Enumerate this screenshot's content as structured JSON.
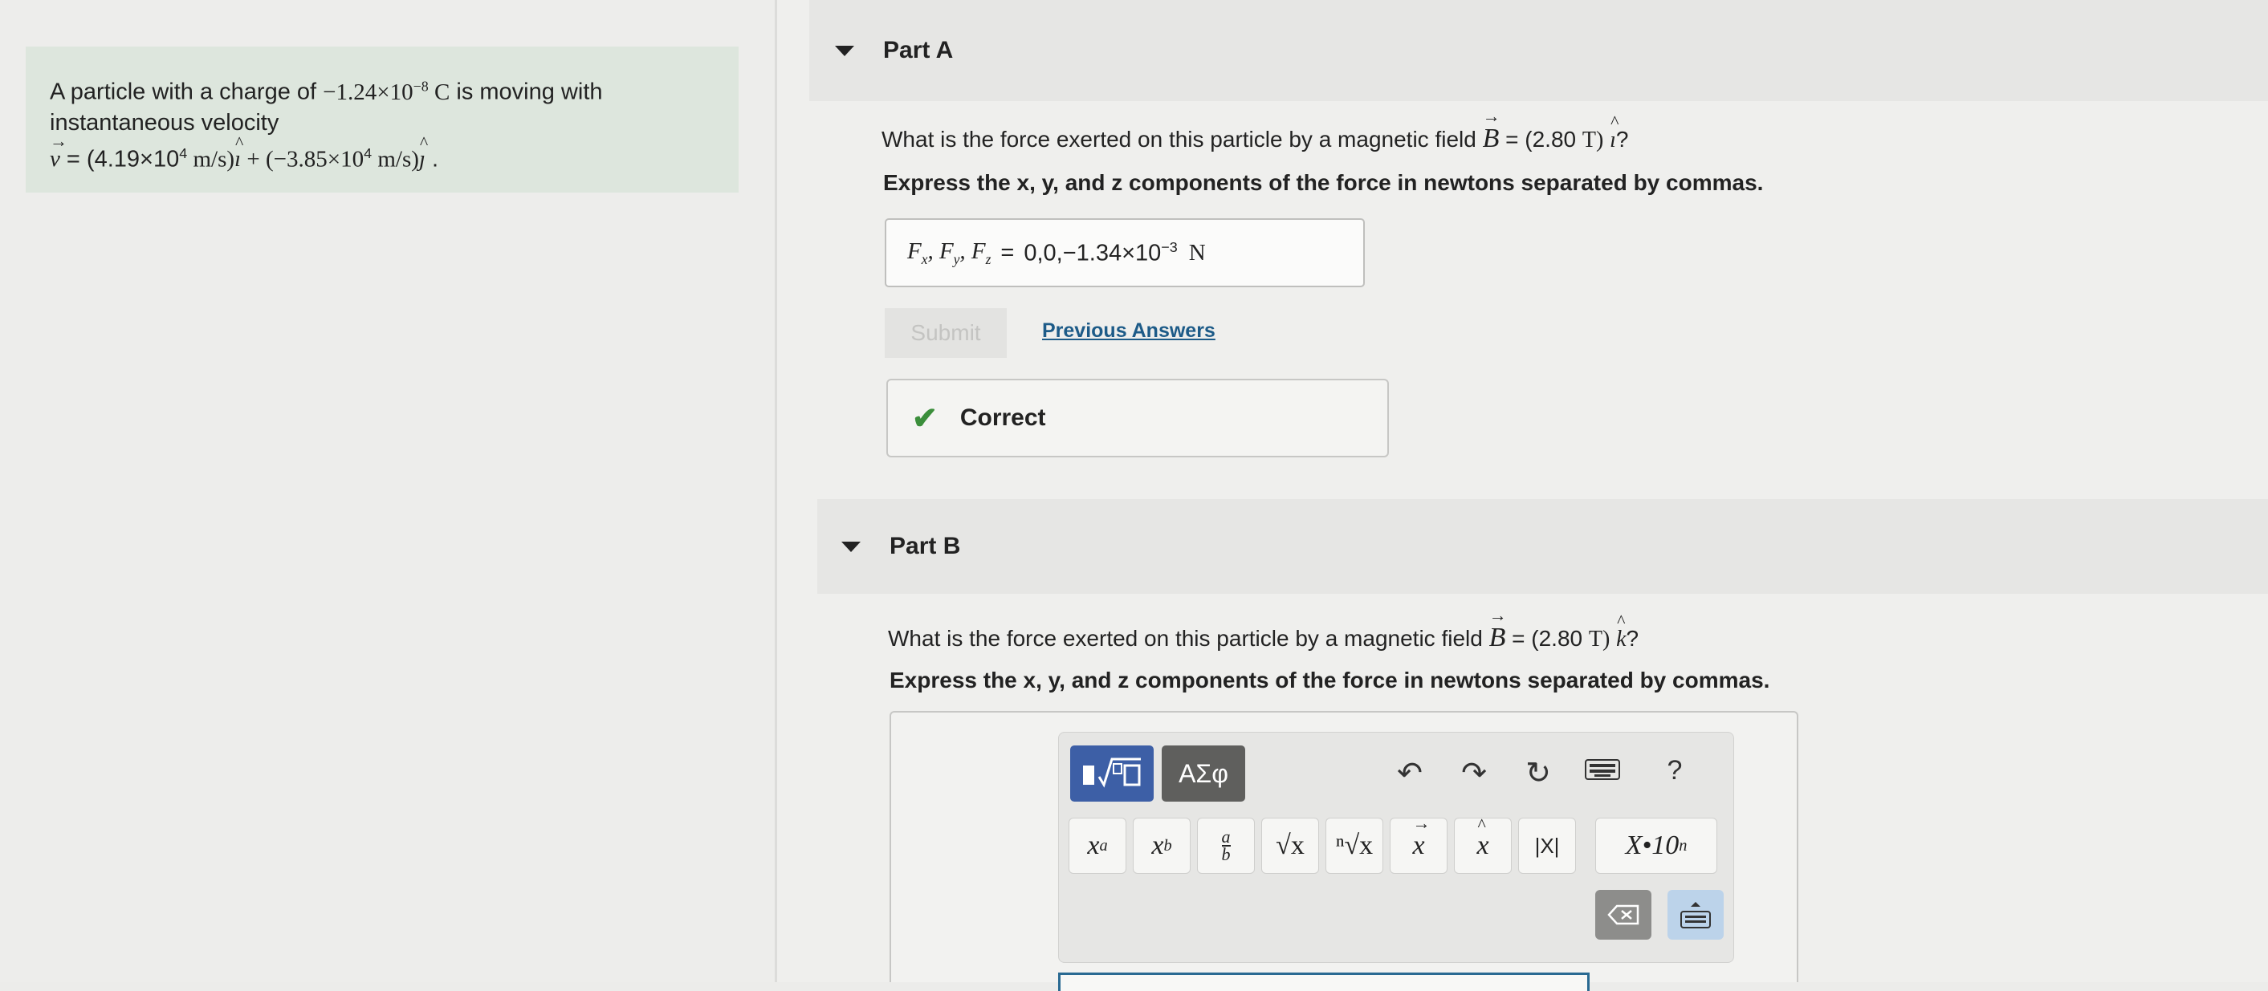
{
  "problem": {
    "line1_prefix": "A particle with a charge of ",
    "charge_sign_value": "−1.24×10",
    "charge_exp": "−8",
    "charge_unit": " C",
    "line1_suffix": " is moving with",
    "line2": "instantaneous velocity",
    "velocity_symbol": "v",
    "velocity_eq": " = (4.19×10",
    "vx_exp": "4",
    "vx_unit": " m/s)",
    "i_hat": "ı",
    "plus": " + (−3.85×10",
    "vy_exp": "4",
    "vy_unit": " m/s)",
    "j_hat": "ȷ",
    "end": " ."
  },
  "partA": {
    "label": "Part A",
    "question_prefix": "What is the force exerted on this particle by a magnetic field ",
    "b_symbol": "B",
    "b_value": " = (2.80 ",
    "b_unit": "T)",
    "unit_vec": "ı",
    "question_suffix": "?",
    "instruction": "Express the x, y, and z components of the force in newtons separated by commas.",
    "answer_label": "F",
    "answer_value": "0,0,−1.34×10",
    "answer_exp": "−3",
    "answer_unit": "N",
    "submit_label": "Submit",
    "previous_answers_label": "Previous Answers",
    "feedback": "Correct"
  },
  "partB": {
    "label": "Part B",
    "question_prefix": "What is the force exerted on this particle by a magnetic field ",
    "b_symbol": "B",
    "b_value": " = (2.80 ",
    "b_unit": "T)",
    "unit_vec": "k",
    "question_suffix": "?",
    "instruction": "Express the x, y, and z components of the force in newtons separated by commas."
  },
  "palette": {
    "greek_tab": "ΑΣφ",
    "help": "?",
    "keys": [
      "x",
      "x",
      "a",
      "√x",
      "ⁿ√x",
      "x",
      "x",
      "|X|",
      "X•10"
    ],
    "key_power_sup": "a",
    "key_sub": "b",
    "key_frac_num": "a",
    "key_frac_den": "b",
    "key_sci_sup": "n"
  },
  "colors": {
    "accent": "#3d5fa6",
    "link": "#1d5b88",
    "correct": "#3b8e3b",
    "problem_bg": "#dde6dd"
  }
}
